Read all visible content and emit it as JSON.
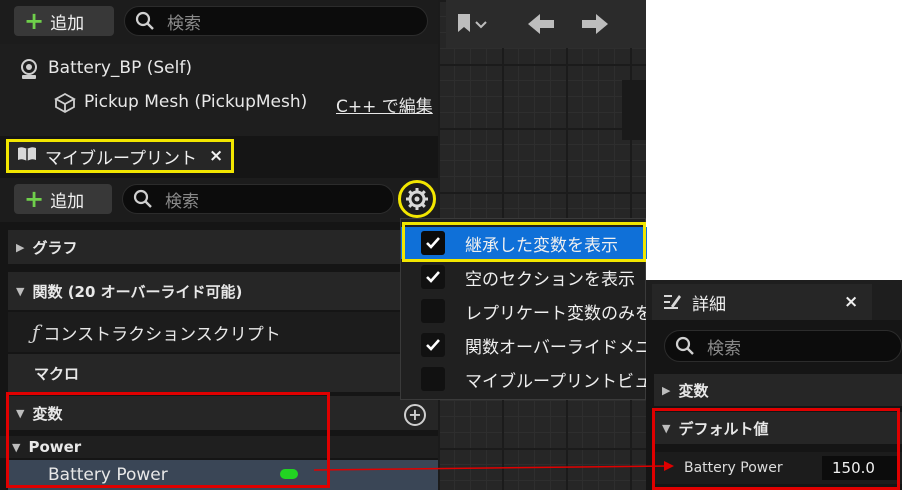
{
  "components": {
    "add_label": "追加",
    "search_placeholder": "検索",
    "self_item": "Battery_BP (Self)",
    "mesh_item": "Pickup Mesh (PickupMesh)",
    "edit_cpp_link": "C++ で編集"
  },
  "my_blueprint": {
    "tab_label": "マイブループリント",
    "tab_close": "×",
    "add_label": "追加",
    "search_placeholder": "検索",
    "sections": {
      "graphs": "グラフ",
      "functions": "関数 (20 オーバーライド可能)",
      "construction_script": "コンストラクションスクリプト",
      "macros": "マクロ",
      "variables": "変数",
      "category_power": "Power",
      "battery_power": "Battery Power"
    },
    "variable_type_color": "#22d422"
  },
  "view_options_menu": {
    "items": [
      {
        "label": "継承した変数を表示",
        "checked": true
      },
      {
        "label": "空のセクションを表示",
        "checked": true
      },
      {
        "label": "レプリケート変数のみを",
        "checked": false
      },
      {
        "label": "関数オーバーライドメニ",
        "checked": true
      },
      {
        "label": "マイブループリントビュ",
        "checked": false
      }
    ]
  },
  "details": {
    "title": "詳細",
    "close": "×",
    "search_placeholder": "検索",
    "section_variables": "変数",
    "section_default": "デフォルト値",
    "property_name": "Battery Power",
    "property_value": "150.0"
  },
  "colors": {
    "highlight_yellow": "#f2e600",
    "highlight_red": "#e00000",
    "menu_selected": "#0f70d8"
  }
}
